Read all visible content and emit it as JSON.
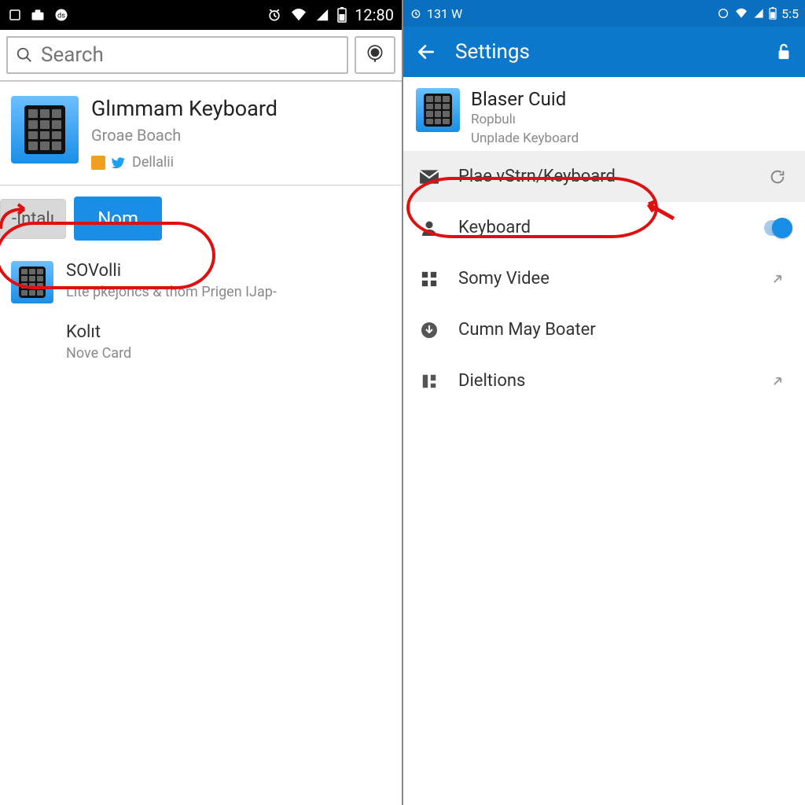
{
  "left": {
    "statusbar": {
      "time": "12:80"
    },
    "search": {
      "placeholder": "Search"
    },
    "app": {
      "title": "Glımmam Keyboard",
      "publisher": "Groae Boach",
      "meta_text": "Dellalii"
    },
    "buttons": {
      "install": "-Intalı",
      "nom": "Nom"
    },
    "list": [
      {
        "title": "SOVolli",
        "sub": "Lite pkejoncs & thom Prigen IJap-"
      },
      {
        "title": "Kolıt",
        "sub": "Nove Card"
      }
    ]
  },
  "right": {
    "statusbar": {
      "left": "131 W",
      "time": "5:5"
    },
    "appbar": {
      "title": "Settings"
    },
    "header": {
      "title": "Blaser Cuid",
      "sub1": "Ropbulı",
      "sub2": "Unplade Keyboard"
    },
    "rows": [
      {
        "label": "Plae vStrn/Keyboard",
        "icon": "mail",
        "tail": "refresh",
        "highlight": true
      },
      {
        "label": "Keyboard",
        "icon": "person",
        "tail": "toggle"
      },
      {
        "label": "Somy Videe",
        "icon": "grid",
        "tail": "arrow"
      },
      {
        "label": "Cumn May Boater",
        "icon": "down",
        "tail": ""
      },
      {
        "label": "Dieltions",
        "icon": "dash",
        "tail": "arrow"
      }
    ]
  }
}
